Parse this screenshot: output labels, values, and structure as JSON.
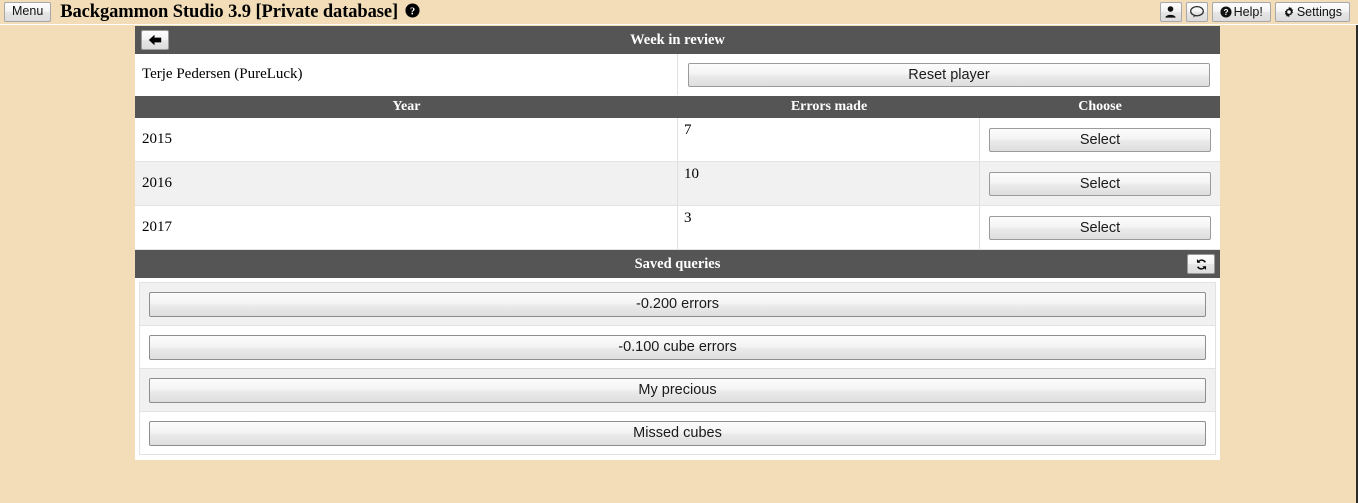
{
  "appbar": {
    "menu_label": "Menu",
    "title": "Backgammon Studio 3.9 [Private database]",
    "help_glyph": "❓",
    "buttons": {
      "user_icon": "user-icon",
      "chat_icon": "chat-bubble-icon",
      "help_label": "Help!",
      "settings_label": "Settings"
    }
  },
  "week_panel": {
    "title": "Week in review",
    "back_icon": "back-arrow-icon",
    "player_name": "Terje Pedersen (PureLuck)",
    "reset_label": "Reset player"
  },
  "year_table": {
    "columns": [
      "Year",
      "Errors made",
      "Choose"
    ],
    "select_label": "Select",
    "rows": [
      {
        "year": "2015",
        "errors": "7"
      },
      {
        "year": "2016",
        "errors": "10"
      },
      {
        "year": "2017",
        "errors": "3"
      }
    ]
  },
  "saved_queries": {
    "title": "Saved queries",
    "refresh_icon": "refresh-icon",
    "items": [
      {
        "label": "-0.200 errors"
      },
      {
        "label": "-0.100 cube errors"
      },
      {
        "label": "My precious"
      },
      {
        "label": "Missed cubes"
      }
    ]
  },
  "colors": {
    "page_background": "#f2ddb8",
    "header_bar": "#555555",
    "panel_background": "#ffffff",
    "row_stripe": "#f1f1f1"
  }
}
